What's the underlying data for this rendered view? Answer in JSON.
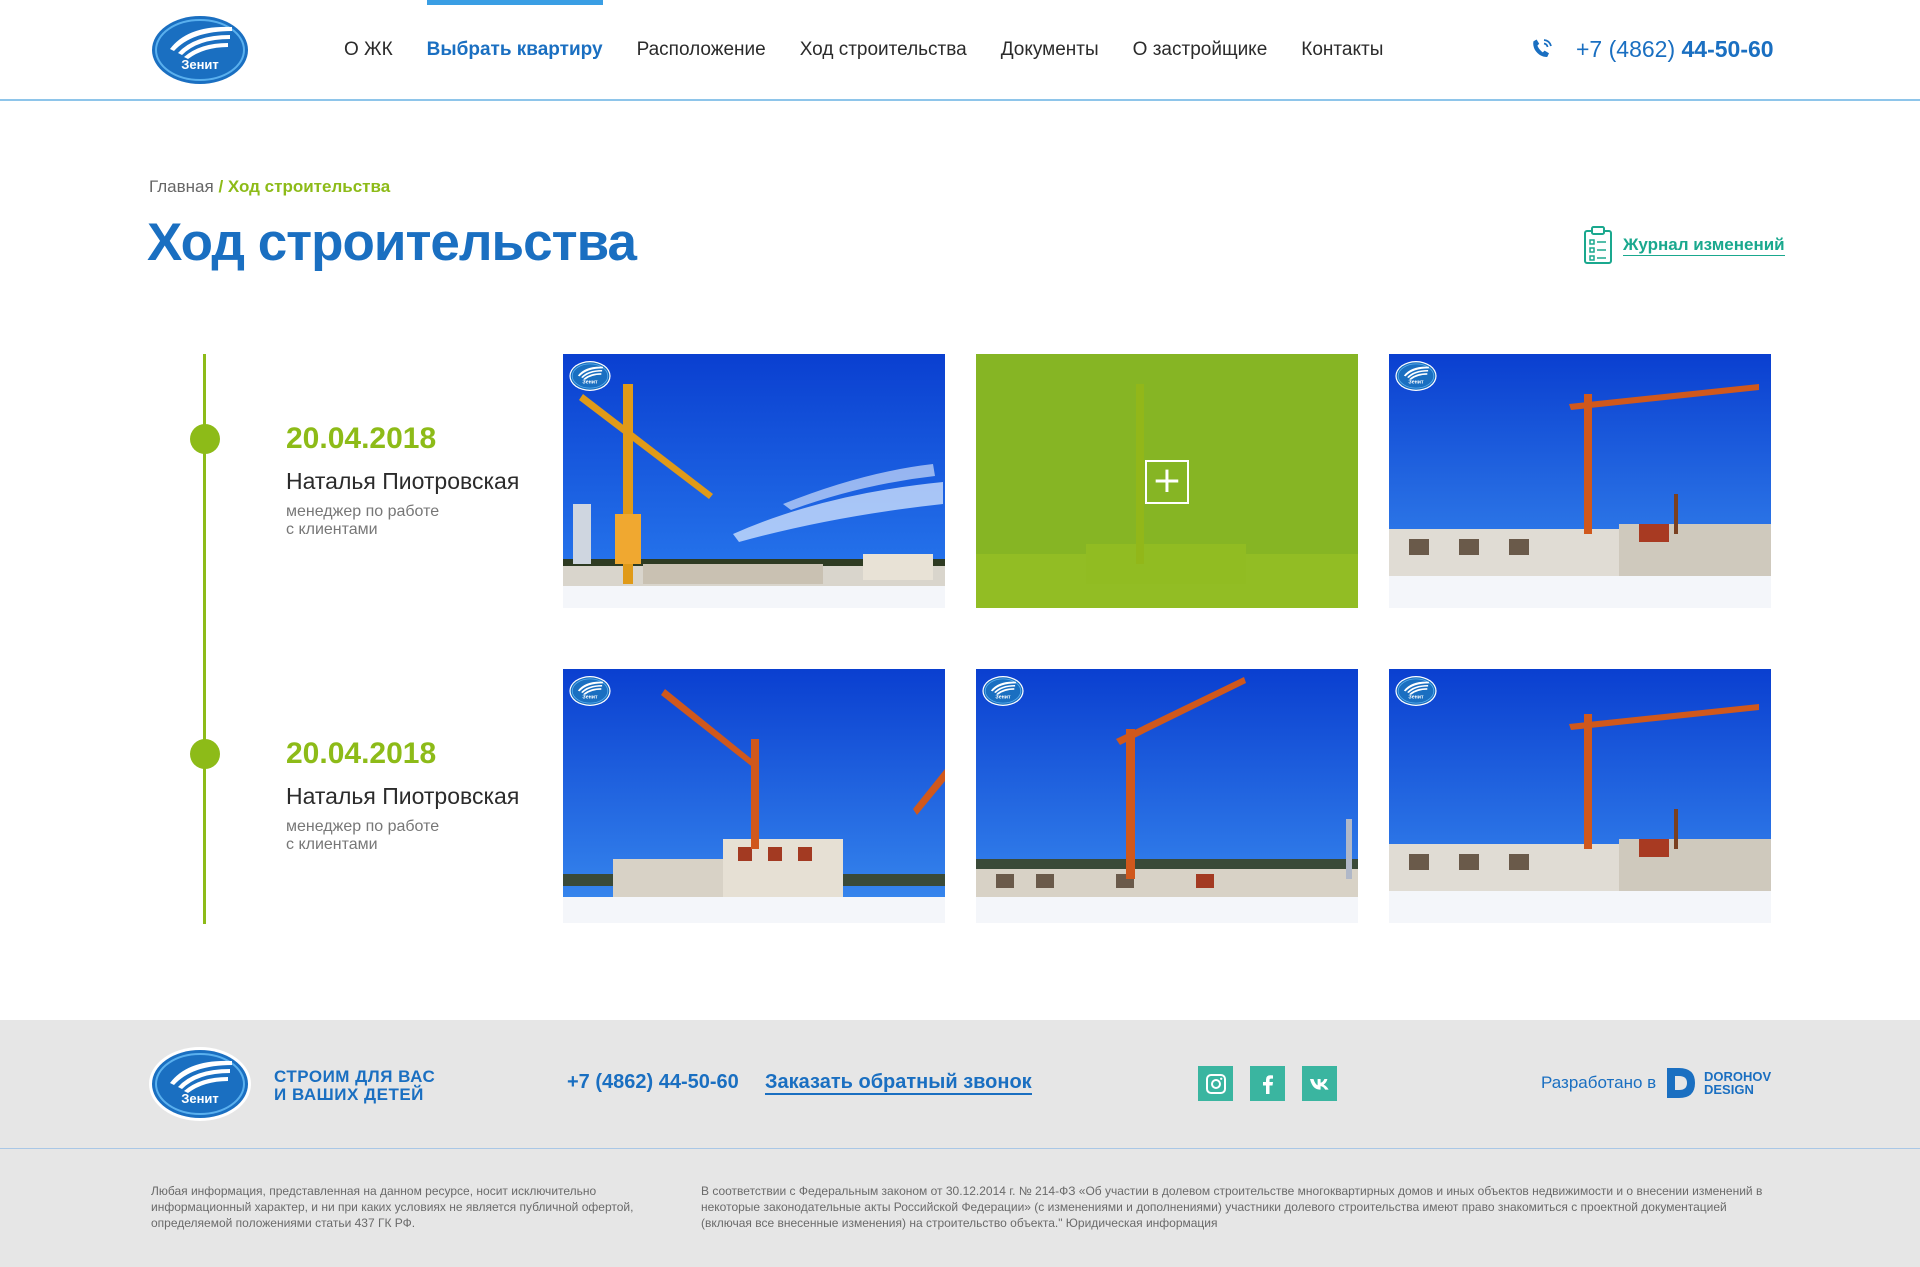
{
  "brand": {
    "logo_text": "Зенит",
    "primary_color": "#1a6fc1",
    "accent_green": "#8dbb18",
    "teal": "#1aa88e"
  },
  "header": {
    "nav": [
      {
        "label": "О ЖК",
        "active": false
      },
      {
        "label": "Выбрать квартиру",
        "active": true
      },
      {
        "label": "Расположение",
        "active": false
      },
      {
        "label": "Ход строительства",
        "active": false
      },
      {
        "label": "Документы",
        "active": false
      },
      {
        "label": "О застройщике",
        "active": false
      },
      {
        "label": "Контакты",
        "active": false
      }
    ],
    "phone_prefix": "+7 (4862) ",
    "phone_main": "44-50-60",
    "phone_icon": "phone-icon"
  },
  "breadcrumb": {
    "home": "Главная",
    "separator": " / ",
    "current": "Ход строительства"
  },
  "page": {
    "title": "Ход строительства",
    "journal_link": "Журнал изменений",
    "journal_icon": "clipboard-icon"
  },
  "entries": [
    {
      "date": "20.04.2018",
      "author": "Наталья Пиотровская",
      "role_line1": "менеджер по работе",
      "role_line2": "с клиентами",
      "photos": [
        {
          "alt": "construction-photo-crane-left",
          "hovered": false
        },
        {
          "alt": "construction-photo-overlay",
          "hovered": true
        },
        {
          "alt": "construction-photo-crane-right",
          "hovered": false
        }
      ]
    },
    {
      "date": "20.04.2018",
      "author": "Наталья Пиотровская",
      "role_line1": "менеджер по работе",
      "role_line2": "с клиентами",
      "photos": [
        {
          "alt": "construction-photo-building",
          "hovered": false
        },
        {
          "alt": "construction-photo-crane-center",
          "hovered": false
        },
        {
          "alt": "construction-photo-crane-right-2",
          "hovered": false
        }
      ]
    }
  ],
  "footer": {
    "slogan_line1": "СТРОИМ ДЛЯ ВАС",
    "slogan_line2": "И ВАШИХ ДЕТЕЙ",
    "phone": "+7 (4862) 44-50-60",
    "callback": "Заказать обратный звонок",
    "socials": [
      "instagram-icon",
      "facebook-icon",
      "vk-icon"
    ],
    "developed_by": "Разработано в",
    "developer_line1": "DOROHOV",
    "developer_line2": "DESIGN",
    "disclaimer_left": "Любая информация, представленная на данном ресурсе, носит исключительно информационный характер, и ни при каких условиях не является публичной офертой, определяемой положениями статьи 437 ГК РФ.",
    "disclaimer_right": "В соответствии с Федеральным законом от 30.12.2014 г. № 214-ФЗ «Об участии в долевом строительстве многоквартирных домов и иных объектов недвижимости и о внесении изменений в некоторые законодательные акты Российской Федерации» (с изменениями и дополнениями) участники долевого строительства имеют право знакомиться с проектной документацией (включая все внесенные изменения) на строительство объекта.\" Юридическая информация"
  }
}
